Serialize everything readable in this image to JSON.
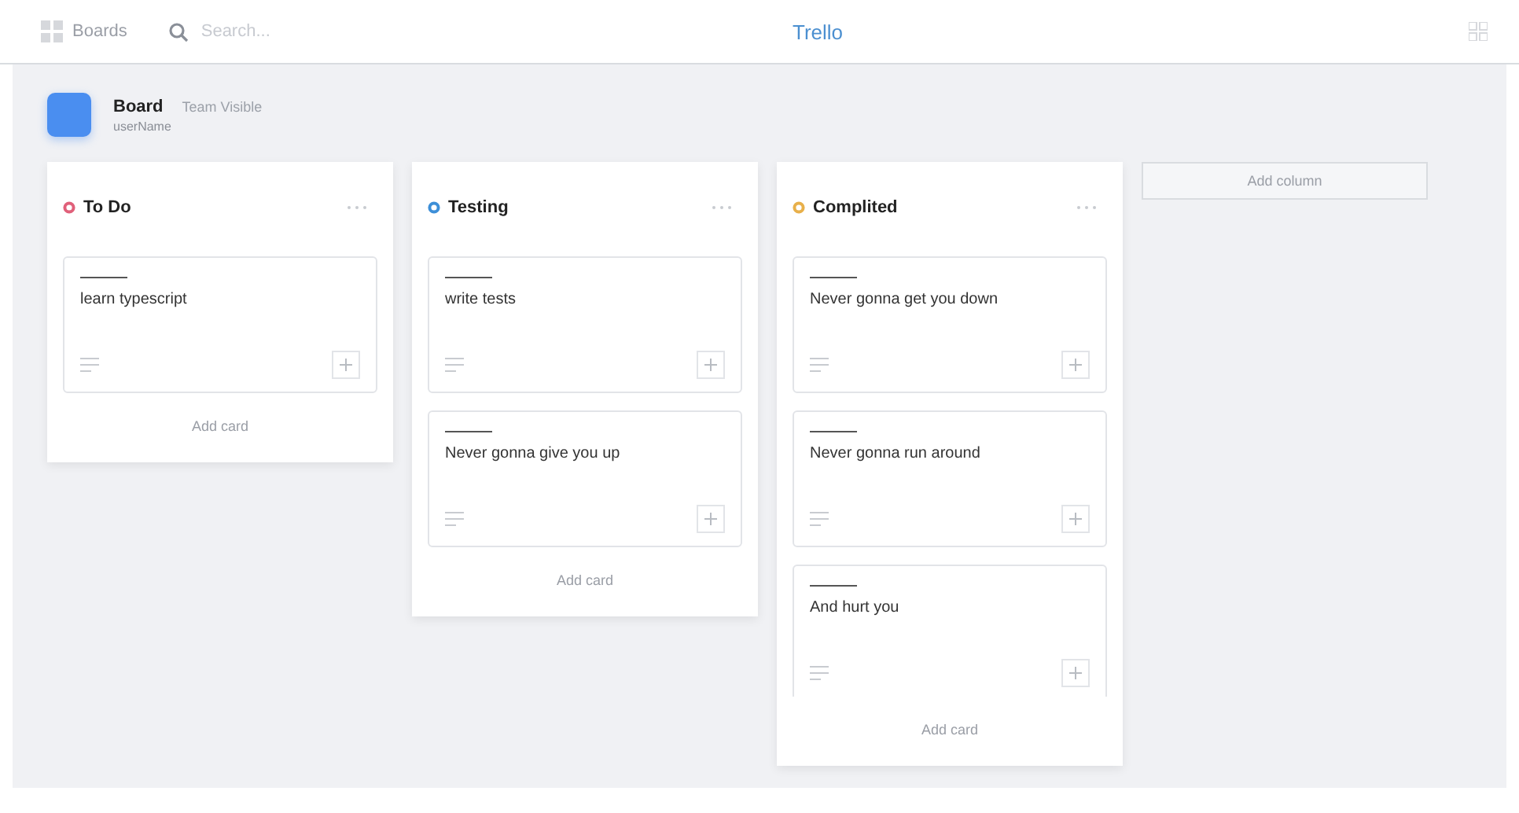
{
  "header": {
    "boards_label": "Boards",
    "search": {
      "placeholder": "Search..."
    },
    "title": "Trello"
  },
  "board": {
    "name": "Board",
    "visibility": "Team Visible",
    "owner": "userName"
  },
  "columns": [
    {
      "title": "To Do",
      "color": "#e0607a",
      "cards": [
        {
          "text": "learn typescript"
        }
      ],
      "add_label": "Add card"
    },
    {
      "title": "Testing",
      "color": "#3d8fd8",
      "cards": [
        {
          "text": "write tests"
        },
        {
          "text": "Never gonna give you up"
        }
      ],
      "add_label": "Add card"
    },
    {
      "title": "Complited",
      "color": "#e8b04a",
      "cards": [
        {
          "text": "Never gonna get you down"
        },
        {
          "text": "Never gonna run around"
        },
        {
          "text": "And hurt you"
        }
      ],
      "add_label": "Add card"
    }
  ],
  "add_column_label": "Add column"
}
